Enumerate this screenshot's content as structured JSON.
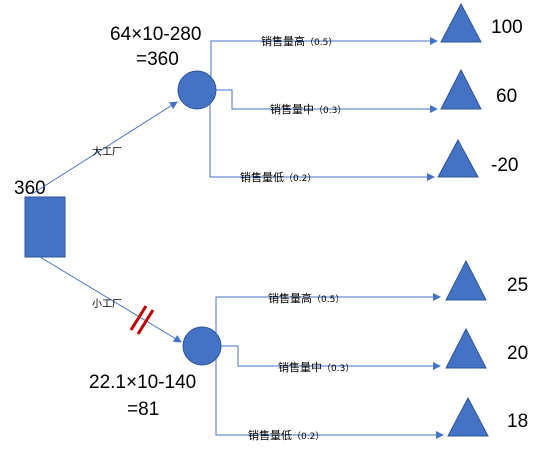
{
  "root": {
    "value": "360"
  },
  "branches": {
    "big": {
      "label": "大工厂"
    },
    "small": {
      "label": "小工厂"
    }
  },
  "chance_nodes": {
    "big": {
      "formula_line1": "64×10-280",
      "formula_line2": "=360"
    },
    "small": {
      "formula_line1": "22.1×10-140",
      "formula_line2": "=81"
    }
  },
  "outcomes": {
    "big": [
      {
        "label": "销售量高",
        "prob": "（0.5）",
        "payoff": "100"
      },
      {
        "label": "销售量中",
        "prob": "（0.3）",
        "payoff": "60"
      },
      {
        "label": "销售量低",
        "prob": "（0.2）",
        "payoff": "-20"
      }
    ],
    "small": [
      {
        "label": "销售量高",
        "prob": "（0.5）",
        "payoff": "25"
      },
      {
        "label": "销售量中",
        "prob": "（0.3）",
        "payoff": "20"
      },
      {
        "label": "销售量低",
        "prob": "（0.2）",
        "payoff": "18"
      }
    ]
  },
  "colors": {
    "node_fill": "#4472C4",
    "line": "#4472C4",
    "prune_mark": "#C00000"
  }
}
